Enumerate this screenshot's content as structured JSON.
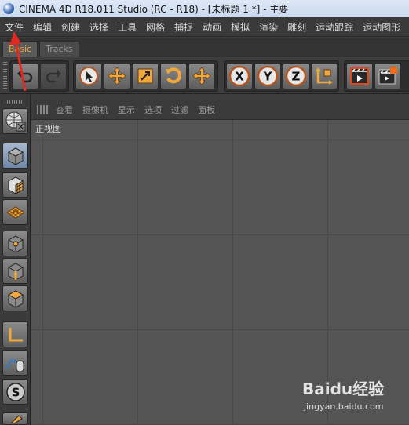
{
  "window": {
    "title": "CINEMA 4D R18.011 Studio (RC - R18) - [未标题 1 *] - 主要"
  },
  "menu": {
    "items": [
      "文件",
      "编辑",
      "创建",
      "选择",
      "工具",
      "网格",
      "捕捉",
      "动画",
      "模拟",
      "渲染",
      "雕刻",
      "运动跟踪",
      "运动图形"
    ]
  },
  "tabs": [
    {
      "label": "Basic"
    },
    {
      "label": "Tracks"
    }
  ],
  "toolbar": {
    "buttons": [
      "undo-icon",
      "redo-icon",
      "select-cursor-icon",
      "move-icon",
      "scale-icon",
      "rotate-icon",
      "last-tool-icon",
      "lock-x-icon",
      "lock-y-icon",
      "lock-z-icon",
      "coordinate-system-icon",
      "render-view-icon",
      "render-picture-viewer-icon"
    ],
    "axis_x": "X",
    "axis_y": "Y",
    "axis_z": "Z"
  },
  "leftpanel": {
    "buttons": [
      "make-editable-icon",
      "model-mode-icon",
      "texture-mode-icon",
      "workplane-mode-icon",
      "points-mode-icon",
      "edges-mode-icon",
      "polygons-mode-icon",
      "enable-axis-icon",
      "tweak-mode-icon",
      "snap-icon"
    ],
    "snap_label": "S"
  },
  "viewport": {
    "menus": [
      "查看",
      "摄像机",
      "显示",
      "选项",
      "过滤",
      "面板"
    ],
    "label": "正视图"
  },
  "watermark": {
    "brand": "Baidu经验",
    "url": "jingyan.baidu.com"
  },
  "colors": {
    "accent_orange": "#f0a83c",
    "viewport_bg": "#545454",
    "annotation_red": "#e02a1f"
  }
}
